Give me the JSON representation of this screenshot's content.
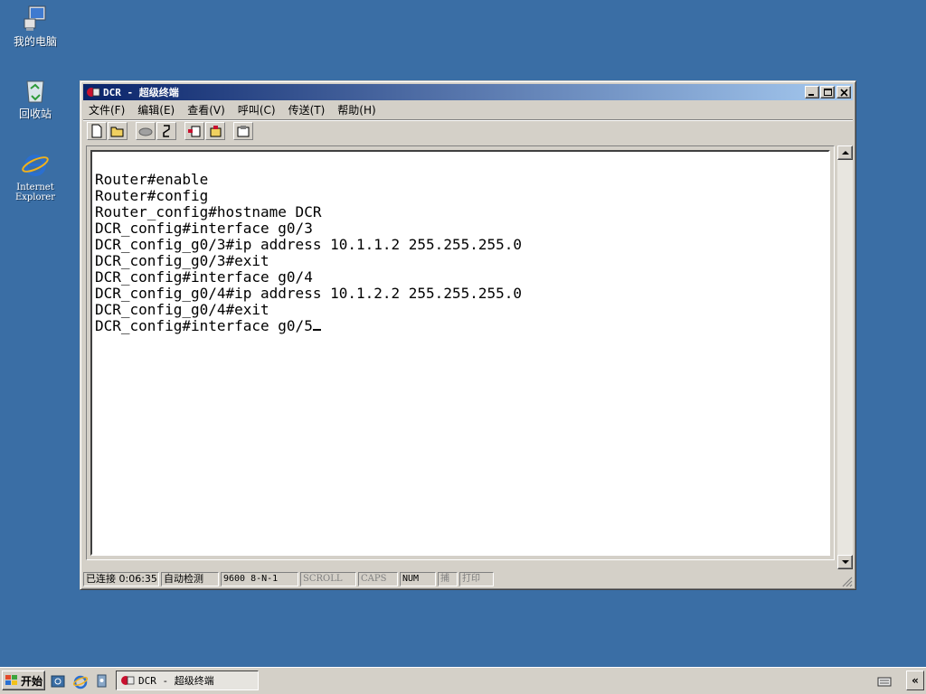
{
  "desktop": {
    "icons": [
      {
        "label": "我的电脑",
        "icon": "my-computer-icon"
      },
      {
        "label": "回收站",
        "icon": "recycle-bin-icon"
      },
      {
        "label": "Internet Explorer",
        "icon": "internet-explorer-icon"
      }
    ]
  },
  "window": {
    "title": "DCR - 超级终端",
    "menu": [
      "文件(F)",
      "编辑(E)",
      "查看(V)",
      "呼叫(C)",
      "传送(T)",
      "帮助(H)"
    ],
    "toolbar": [
      "new-icon",
      "open-icon",
      "connect-icon",
      "disconnect-icon",
      "send-icon",
      "receive-icon",
      "properties-icon"
    ],
    "terminal": {
      "lines": [
        "Router#enable",
        "Router#config",
        "Router_config#hostname DCR",
        "DCR_config#interface g0/3",
        "DCR_config_g0/3#ip address 10.1.1.2 255.255.255.0",
        "DCR_config_g0/3#exit",
        "DCR_config#interface g0/4",
        "DCR_config_g0/4#ip address 10.1.2.2 255.255.255.0",
        "DCR_config_g0/4#exit",
        "DCR_config#interface g0/5"
      ]
    },
    "status": {
      "connected": "已连接 0:06:35",
      "detect": "自动检测",
      "baud": "9600 8-N-1",
      "scroll": "SCROLL",
      "caps": "CAPS",
      "num": "NUM",
      "capture": "捕",
      "print": "打印"
    }
  },
  "taskbar": {
    "start_label": "开始",
    "task_title": "DCR - 超级终端",
    "quicklaunch": [
      "show-desktop-icon",
      "internet-explorer-icon",
      "media-icon"
    ],
    "tray_toggle": "«"
  }
}
